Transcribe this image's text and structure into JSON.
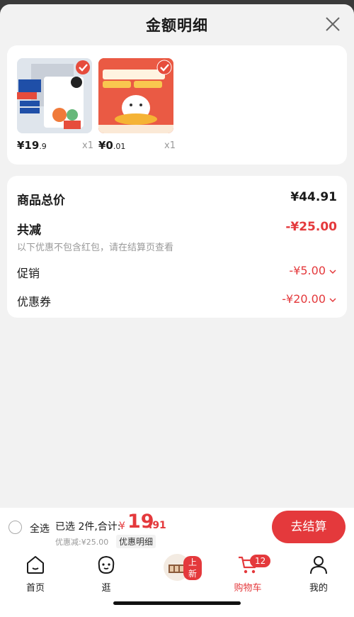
{
  "header": {
    "title": "金额明细"
  },
  "items": [
    {
      "price_int": "¥19",
      "price_dec": ".9",
      "qty": "x1",
      "thumb_texts": [
        "衣物除菌液",
        "13.3",
        "母婴可用",
        "99",
        "UG"
      ]
    },
    {
      "price_int": "¥0",
      "price_dec": ".01",
      "qty": "x1",
      "thumb_texts": [
        "免费补贴1818京豆",
        "全场商家补贴"
      ]
    }
  ],
  "summary": {
    "total_label": "商品总价",
    "total_value": "¥44.91",
    "reduce_label": "共减",
    "reduce_value": "-¥25.00",
    "note": "以下优惠不包含红包，请在结算页查看",
    "promo_label": "促销",
    "promo_value": "-¥5.00",
    "coupon_label": "优惠券",
    "coupon_value": "-¥20.00"
  },
  "checkout_bar": {
    "select_all": "全选",
    "selected_text": "已选 2件,合计:",
    "total_yen": "¥",
    "total_int": "19",
    "total_dec": ".91",
    "discount_text": "优惠减:¥25.00",
    "detail_link": "优惠明细",
    "checkout_button": "去结算"
  },
  "nav": {
    "tabs": [
      {
        "label": "首页",
        "icon": "home-icon"
      },
      {
        "label": "逛",
        "icon": "browse-icon"
      },
      {
        "label": "",
        "icon": "new-arrival-icon",
        "badge": "上新"
      },
      {
        "label": "购物车",
        "icon": "cart-icon",
        "badge": "12",
        "active": true
      },
      {
        "label": "我的",
        "icon": "profile-icon"
      }
    ]
  },
  "colors": {
    "accent": "#e4393c",
    "background": "#f2f2f2"
  }
}
